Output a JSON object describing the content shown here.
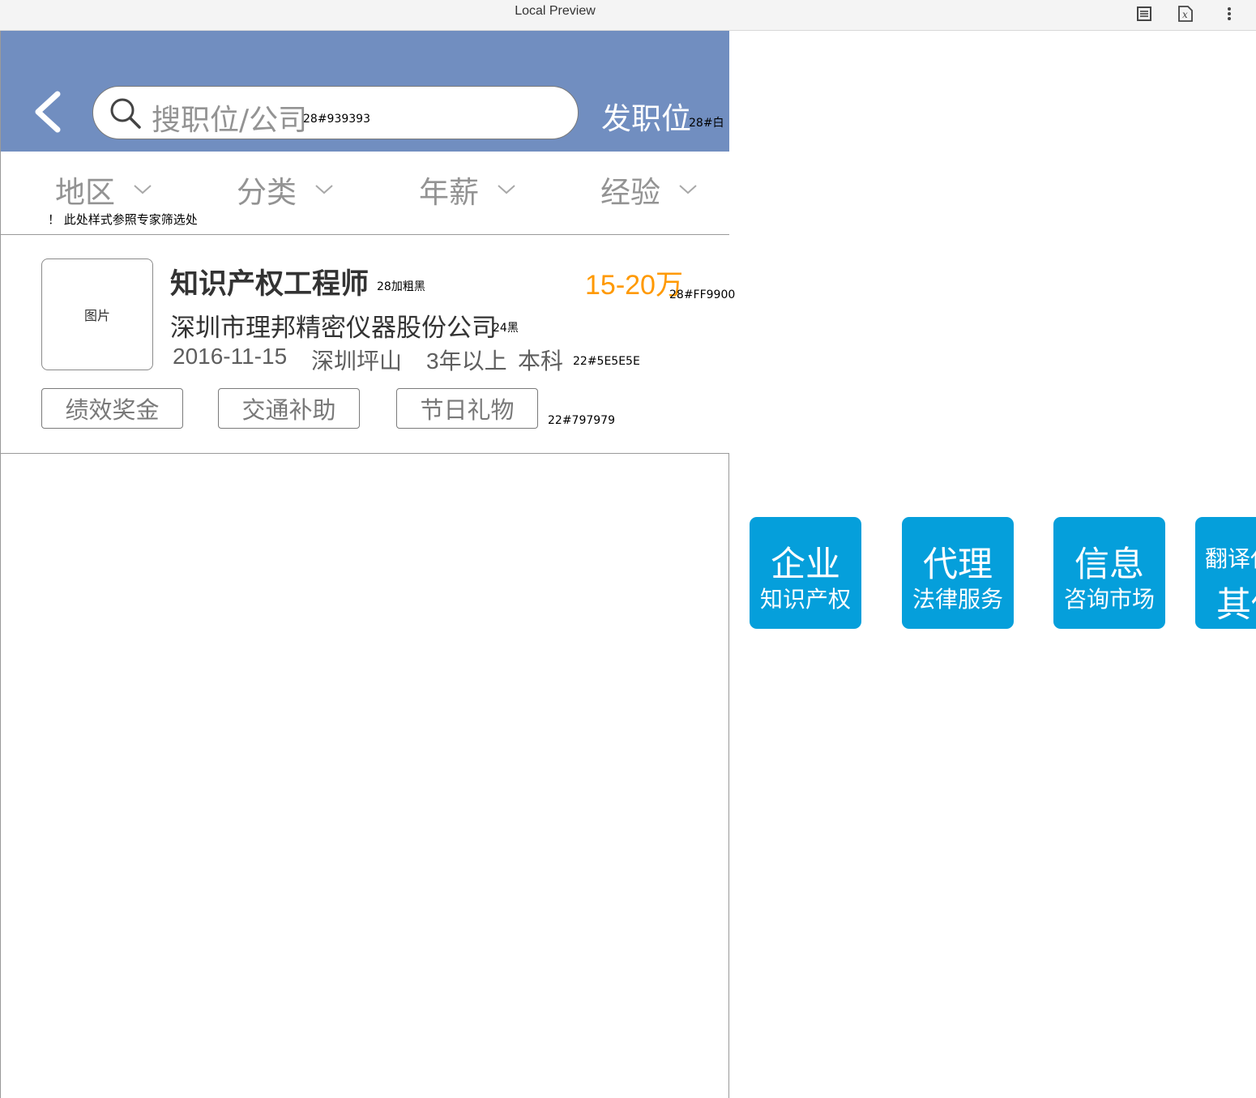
{
  "window": {
    "title": "Local Preview",
    "icons": [
      "page-icon",
      "variable-icon",
      "more-vertical-icon"
    ]
  },
  "header": {
    "back_icon": "chevron-left-icon",
    "search": {
      "icon": "search-icon",
      "placeholder": "搜职位/公司",
      "spec_note": "28#939393"
    },
    "post_job_label": "发职位",
    "post_job_note": "28#白",
    "background_color": "#718ec0"
  },
  "filters": {
    "items": [
      {
        "label": "地区"
      },
      {
        "label": "分类"
      },
      {
        "label": "年薪"
      },
      {
        "label": "经验"
      }
    ],
    "note": "！ 此处样式参照专家筛选处"
  },
  "job": {
    "image_label": "图片",
    "title": "知识产权工程师",
    "title_note": "28加粗黑",
    "salary": "15-20万",
    "salary_note": "28#FF9900",
    "company": "深圳市理邦精密仪器股份公司",
    "company_note": "24黑",
    "date": "2016-11-15",
    "location": "深圳坪山",
    "experience": "3年以上",
    "education": "本科",
    "meta_note": "22#5E5E5E",
    "tags": [
      "绩效奖金",
      "交通补助",
      "节日礼物"
    ],
    "tags_note": "22#797979"
  },
  "tiles": [
    {
      "main": "企业",
      "sub": "知识产权"
    },
    {
      "main": "代理",
      "sub": "法律服务"
    },
    {
      "main": "信息",
      "sub": "咨询市场"
    },
    {
      "main": "其他",
      "sub": "翻译代"
    }
  ],
  "colors": {
    "header": "#718ec0",
    "salary": "#ff9900",
    "tile": "#059fdb",
    "placeholder": "#939393",
    "meta": "#5e5e5e",
    "tag": "#797979"
  }
}
